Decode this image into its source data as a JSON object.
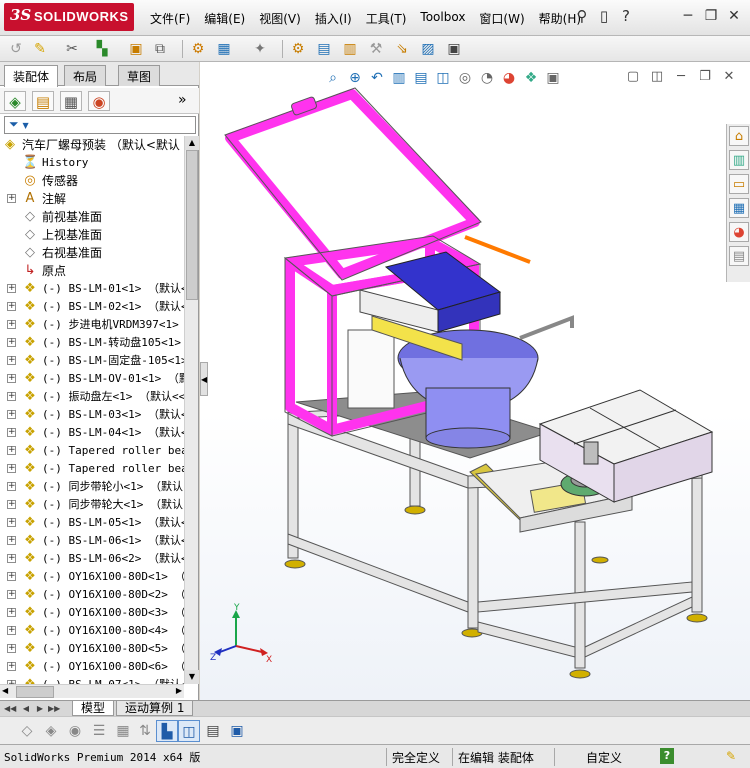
{
  "app": {
    "logo_text": "SOLIDWORKS",
    "logo_mark": "3S",
    "menus": [
      "文件(F)",
      "编辑(E)",
      "视图(V)",
      "插入(I)",
      "工具(T)",
      "Toolbox",
      "窗口(W)",
      "帮助(H)"
    ]
  },
  "title_icons": [
    "pin-icon",
    "new-document-icon",
    "question-icon"
  ],
  "window_controls": [
    "minimize-icon",
    "restore-icon",
    "close-icon"
  ],
  "feature_manager": {
    "tabs": [
      "装配体",
      "布局",
      "草图"
    ],
    "active_tab": "装配体",
    "icons": [
      "feature-tree-icon",
      "property-manager-icon",
      "configuration-manager-icon",
      "appearance-icon"
    ],
    "expand_glyph": "»",
    "filter_glyph": "▼",
    "tree": {
      "root": "汽车厂螺母预装 （默认<默认",
      "items": [
        {
          "label": "History",
          "icon": "history-icon",
          "kind": "feature"
        },
        {
          "label": "传感器",
          "icon": "sensor-icon",
          "kind": "feature"
        },
        {
          "label": "注解",
          "icon": "annotation-icon",
          "kind": "feature"
        },
        {
          "label": "前视基准面",
          "icon": "plane-icon",
          "kind": "feature"
        },
        {
          "label": "上视基准面",
          "icon": "plane-icon",
          "kind": "feature"
        },
        {
          "label": "右视基准面",
          "icon": "plane-icon",
          "kind": "feature"
        },
        {
          "label": "原点",
          "icon": "origin-icon",
          "kind": "feature"
        },
        {
          "label": "(-) BS-LM-01<1> （默认<<",
          "icon": "part-icon",
          "kind": "part"
        },
        {
          "label": "(-) BS-LM-02<1> （默认<<",
          "icon": "part-icon",
          "kind": "part"
        },
        {
          "label": "(-) 步进电机VRDM397<1>",
          "icon": "part-icon",
          "kind": "part"
        },
        {
          "label": "(-) BS-LM-转动盘105<1>",
          "icon": "part-icon",
          "kind": "part"
        },
        {
          "label": "(-) BS-LM-固定盘-105<1>",
          "icon": "part-icon",
          "kind": "part"
        },
        {
          "label": "(-) BS-LM-OV-01<1> （默认",
          "icon": "part-icon",
          "kind": "part"
        },
        {
          "label": "(-) 振动盘左<1> （默认<<",
          "icon": "part-icon",
          "kind": "part"
        },
        {
          "label": "(-) BS-LM-03<1> （默认<<",
          "icon": "part-icon",
          "kind": "part"
        },
        {
          "label": "(-) BS-LM-04<1> （默认<<",
          "icon": "part-icon",
          "kind": "part"
        },
        {
          "label": "(-) Tapered roller bear",
          "icon": "part-icon",
          "kind": "part"
        },
        {
          "label": "(-) Tapered roller bear",
          "icon": "part-icon",
          "kind": "part"
        },
        {
          "label": "(-) 同步带轮小<1> （默认",
          "icon": "part-icon",
          "kind": "part"
        },
        {
          "label": "(-) 同步带轮大<1> （默认",
          "icon": "part-icon",
          "kind": "part"
        },
        {
          "label": "(-) BS-LM-05<1> （默认<<",
          "icon": "part-icon",
          "kind": "part"
        },
        {
          "label": "(-) BS-LM-06<1> （默认<<",
          "icon": "part-icon",
          "kind": "part"
        },
        {
          "label": "(-) BS-LM-06<2> （默认<<",
          "icon": "part-icon",
          "kind": "part"
        },
        {
          "label": "(-) OY16X100-80D<1> （默",
          "icon": "part-icon",
          "kind": "part"
        },
        {
          "label": "(-) OY16X100-80D<2> （默",
          "icon": "part-icon",
          "kind": "part"
        },
        {
          "label": "(-) OY16X100-80D<3> （默",
          "icon": "part-icon",
          "kind": "part"
        },
        {
          "label": "(-) OY16X100-80D<4> （默",
          "icon": "part-icon",
          "kind": "part"
        },
        {
          "label": "(-) OY16X100-80D<5> （默",
          "icon": "part-icon",
          "kind": "part"
        },
        {
          "label": "(-) OY16X100-80D<6> （默",
          "icon": "part-icon",
          "kind": "part"
        },
        {
          "label": "(-) BS-LM-07<1> （默认<<",
          "icon": "part-icon",
          "kind": "part"
        }
      ]
    }
  },
  "graphics": {
    "heads_up_view_icons": [
      "zoom-to-fit-icon",
      "zoom-area-icon",
      "previous-view-icon",
      "section-view-icon",
      "dynamic-annotation-icon",
      "view-orientation-icon",
      "display-style-icon",
      "hide-show-icon",
      "edit-appearance-icon",
      "apply-scene-icon",
      "view-settings-icon"
    ],
    "window_controls": [
      "tile-icon",
      "split-icon",
      "minimize-icon",
      "restore-icon",
      "close-icon"
    ],
    "task_pane": [
      "home-icon",
      "design-library-icon",
      "file-explorer-icon",
      "view-palette-icon",
      "appearances-icon",
      "custom-properties-icon"
    ],
    "triad": {
      "x": "X",
      "y": "Y",
      "z": "Z"
    },
    "colors": {
      "frame": "#ff33ee",
      "table": "#dcdcdc",
      "bowl": "#8f8ff2",
      "accent": "#ff7a00"
    }
  },
  "model_tabs": {
    "nav": [
      "◀◀",
      "◀",
      "▶",
      "▶▶"
    ],
    "tabs": [
      "模型",
      "运动算例 1"
    ],
    "active": "模型"
  },
  "bottom_toolbar": [
    "wireframe-icon",
    "hidden-lines-icon",
    "hidden-removed-icon",
    "shaded-edges-icon",
    "shaded-icon",
    "section-icon",
    "render-icon",
    "camera-icon",
    "shaded-with-edges-active-icon",
    "cube-icon",
    "table-icon",
    "save-icon"
  ],
  "status_bar": {
    "product": "SolidWorks Premium 2014 x64 版",
    "state": "完全定义",
    "mode": "在编辑 装配体",
    "units": "自定义",
    "help": "?"
  }
}
